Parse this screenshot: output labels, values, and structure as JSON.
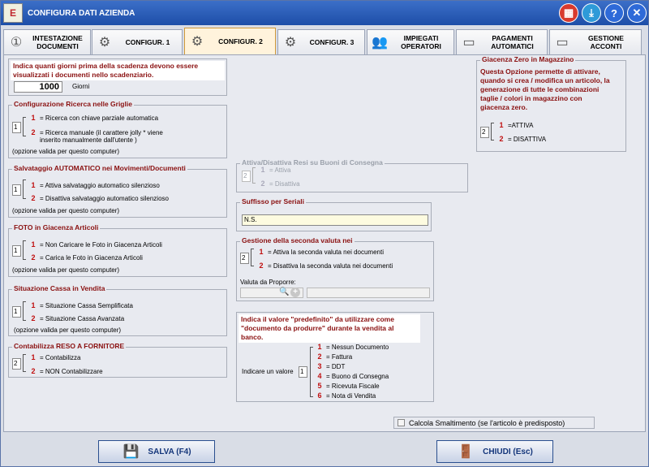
{
  "window": {
    "title": "CONFIGURA DATI AZIENDA",
    "logo_text": "E"
  },
  "title_buttons": [
    {
      "icon": "calculator-icon",
      "color": "#d83a2e"
    },
    {
      "icon": "download-icon",
      "color": "#2e9ad8"
    },
    {
      "icon": "help-icon",
      "symbol": "?",
      "color": "#2e6ad8"
    },
    {
      "icon": "close-icon",
      "symbol": "X",
      "color": "#2e6ad8"
    }
  ],
  "tabs": [
    {
      "l1": "INTESTAZIONE",
      "l2": "DOCUMENTI",
      "icon": "number-one-icon",
      "sym": "①"
    },
    {
      "l1": "CONFIGUR. 1",
      "l2": "",
      "icon": "gear-icon",
      "sym": "⚙"
    },
    {
      "l1": "CONFIGUR. 2",
      "l2": "",
      "icon": "gear-icon",
      "sym": "⚙"
    },
    {
      "l1": "CONFIGUR. 3",
      "l2": "",
      "icon": "gear-icon",
      "sym": "⚙"
    },
    {
      "l1": "IMPIEGATI",
      "l2": "OPERATORI",
      "icon": "users-icon",
      "sym": "👥"
    },
    {
      "l1": "PAGAMENTI",
      "l2": "AUTOMATICI",
      "icon": "card-icon",
      "sym": "▭"
    },
    {
      "l1": "GESTIONE",
      "l2": "ACCONTI",
      "icon": "card-icon",
      "sym": "▭"
    }
  ],
  "scadenza": {
    "l1": "Indica quanti giorni prima della scadenza devono essere",
    "l2": "visualizzati i documenti nello scadenziario.",
    "value": "1000",
    "unit": "Giorni"
  },
  "ricerca": {
    "title": "Configurazione Ricerca nelle Griglie",
    "sel": "1",
    "o1": "= Ricerca con chiave parziale automatica",
    "o2a": "= Ricerca manuale (il carattere jolly * viene",
    "o2b": "inserito manualmente dall'utente )",
    "note": "(opzione valida per questo computer)"
  },
  "salvataggio": {
    "title": "Salvataggio AUTOMATICO nei Movimenti/Documenti",
    "sel": "1",
    "o1": "= Attiva salvataggio automatico silenzioso",
    "o2": "= Disattiva salvataggio automatico silenzioso",
    "note": "(opzione valida per questo computer)"
  },
  "foto": {
    "title": "FOTO in Giacenza Articoli",
    "sel": "1",
    "o1": "= Non Caricare le Foto in Giacenza Articoli",
    "o2": "= Carica le Foto in Giacenza Articoli",
    "note": "(opzione valida per questo computer)"
  },
  "cassa": {
    "title": "Situazione Cassa in Vendita",
    "sel": "1",
    "o1": "= Situazione Cassa Semplificata",
    "o2": "= Situazione Cassa Avanzata",
    "note": "(opzione valida per questo computer)"
  },
  "reso": {
    "title": "Contabilizza RESO A FORNITORE",
    "sel": "2",
    "o1": "= Contabilizza",
    "o2": "= NON Contabilizzare"
  },
  "resi": {
    "title": "Attiva/Disattiva Resi su Buoni di Consegna",
    "sel": "2",
    "o1": "= Attiva",
    "o2": "= Disattiva"
  },
  "seriali": {
    "title": "Suffisso per Seriali",
    "value": "N.S."
  },
  "valuta": {
    "title": "Gestione della seconda valuta nei",
    "sel": "2",
    "o1": "= Attiva la seconda valuta nei documenti",
    "o2": "= Disattiva la seconda valuta nei documenti",
    "label": "Valuta da Proporre:"
  },
  "predef": {
    "l1": "Indica il valore \"predefinito\" da utilizzare come",
    "l2": "\"documento da produrre\" durante la vendita al",
    "l3": "banco.",
    "label": "Indicare un valore",
    "sel": "1",
    "opts": [
      {
        "n": "1",
        "t": "= Nessun Documento"
      },
      {
        "n": "2",
        "t": "= Fattura"
      },
      {
        "n": "3",
        "t": "= DDT"
      },
      {
        "n": "4",
        "t": "= Buono di Consegna"
      },
      {
        "n": "5",
        "t": "= Ricevuta Fiscale"
      },
      {
        "n": "6",
        "t": "= Nota di Vendita"
      }
    ]
  },
  "giacenza": {
    "title": "Giacenza Zero in Magazzino",
    "l1": "Questa Opzione permette di attivare,",
    "l2": "quando si crea / modifica un articolo, la",
    "l3": "generazione di tutte le combinazioni",
    "l4": "taglie / colori in magazzino con",
    "l5": "giacenza zero.",
    "sel": "2",
    "o1": "=ATTIVA",
    "o2": "= DISATTIVA"
  },
  "smaltimento": {
    "label": "Calcola Smaltimento (se l'articolo è predisposto)"
  },
  "footer": {
    "save": "SALVA (F4)",
    "close": "CHIUDI (Esc)"
  }
}
